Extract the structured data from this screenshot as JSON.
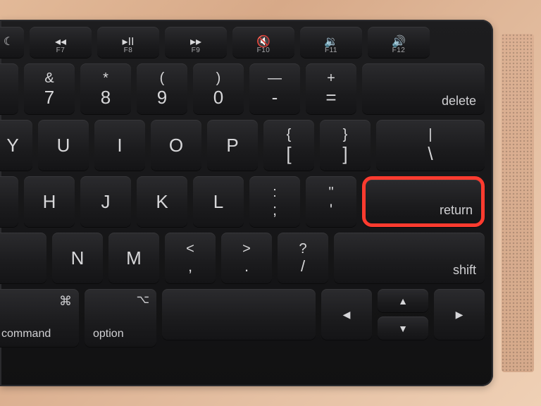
{
  "fnRow": [
    {
      "icon": "☾",
      "label": ""
    },
    {
      "icon": "◂◂",
      "label": "F7"
    },
    {
      "icon": "▸II",
      "label": "F8"
    },
    {
      "icon": "▸▸",
      "label": "F9"
    },
    {
      "icon": "🔇",
      "label": "F10"
    },
    {
      "icon": "🔉",
      "label": "F11"
    },
    {
      "icon": "🔊",
      "label": "F12"
    }
  ],
  "numRow": [
    {
      "top": "&",
      "bot": "7"
    },
    {
      "top": "*",
      "bot": "8"
    },
    {
      "top": "(",
      "bot": "9"
    },
    {
      "top": ")",
      "bot": "0"
    },
    {
      "top": "—",
      "bot": "-"
    },
    {
      "top": "+",
      "bot": "="
    }
  ],
  "deleteLabel": "delete",
  "qRow": {
    "letters": [
      "Y",
      "U",
      "I",
      "O",
      "P"
    ],
    "bracket1": {
      "top": "{",
      "bot": "["
    },
    "bracket2": {
      "top": "}",
      "bot": "]"
    },
    "backslash": {
      "top": "|",
      "bot": "\\"
    }
  },
  "aRow": {
    "letters": [
      "H",
      "J",
      "K",
      "L"
    ],
    "semi": {
      "top": ":",
      "bot": ";"
    },
    "quote": {
      "top": "\"",
      "bot": "'"
    },
    "returnLabel": "return"
  },
  "zRow": {
    "letters": [
      "N",
      "M"
    ],
    "comma": {
      "top": "<",
      "bot": ","
    },
    "period": {
      "top": ">",
      "bot": "."
    },
    "slash": {
      "top": "?",
      "bot": "/"
    },
    "shiftLabel": "shift"
  },
  "bottom": {
    "commandLabel": "command",
    "commandSymbol": "⌘",
    "optionLabel": "option",
    "optionSymbol": "⌥",
    "arrows": {
      "left": "◀",
      "up": "▲",
      "down": "▼",
      "right": "▶"
    }
  }
}
